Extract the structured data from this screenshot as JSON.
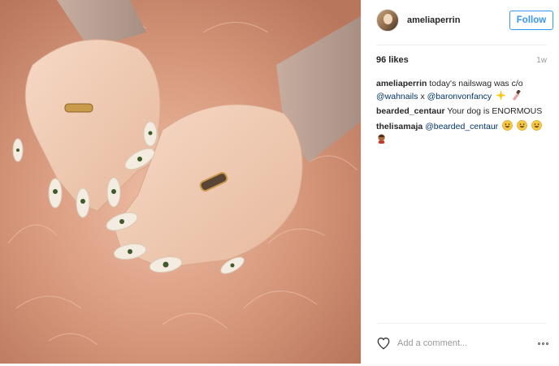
{
  "header": {
    "username": "ameliaperrin",
    "follow_label": "Follow"
  },
  "meta": {
    "likes": "96 likes",
    "time": "1w"
  },
  "comments": [
    {
      "user": "ameliaperrin",
      "text_before": "today's nailswag was c/o",
      "mention1": "@wahnails",
      "middle": "x",
      "mention2": "@baronvonfancy",
      "emoji": [
        "sparkle-icon",
        "nail-polish-icon"
      ]
    },
    {
      "user": "bearded_centaur",
      "text": "Your dog is ENORMOUS"
    },
    {
      "user": "thelisamaja",
      "mention": "@bearded_centaur",
      "emoji": [
        "grinning-face-icon",
        "grinning-face-icon",
        "grinning-face-icon",
        "person-icon"
      ]
    }
  ],
  "footer": {
    "comment_placeholder": "Add a comment..."
  },
  "colors": {
    "accent": "#3897f0",
    "mention": "#003569",
    "muted": "#999999"
  }
}
